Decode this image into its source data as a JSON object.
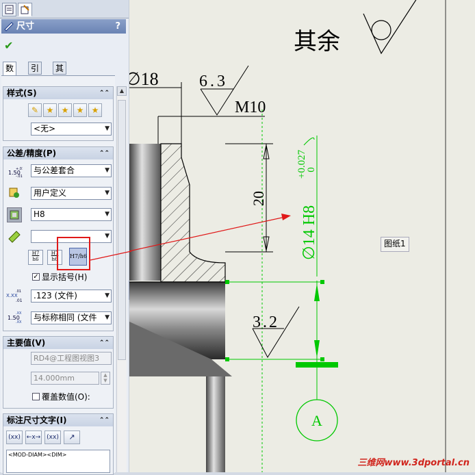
{
  "property_manager": {
    "title": "尺寸",
    "help": "?",
    "tabs": [
      "数值",
      "引线",
      "其它"
    ]
  },
  "style_group": {
    "title": "样式(S)",
    "style_select": "<无>"
  },
  "tolerance_group": {
    "title": "公差/精度(P)",
    "tolerance_type": "与公差套合",
    "classification": "用户定义",
    "hole_fit": "H8",
    "shaft_fit": "",
    "fit_buttons": [
      {
        "top": "H7",
        "bottom": "h6"
      },
      {
        "top": "H7",
        "bottom": "h6"
      },
      {
        "top": "H7",
        "bottom": "h6"
      }
    ],
    "show_parentheses": "显示括号(H)",
    "show_parentheses_checked": true,
    "primary_precision": ".123 (文件)",
    "tolerance_precision": "与标称相同 (文件",
    "icon_label_top": "1.50",
    "icon_label_tol": "+.01\n-.01"
  },
  "primary_value_group": {
    "title": "主要值(V)",
    "reference": "RD4@工程图视图3",
    "value": "14.000mm",
    "override": "覆盖数值(O):"
  },
  "dim_text_group": {
    "title": "标注尺寸文字(I)",
    "text": "<MOD-DIAM><DIM>",
    "buttons": [
      "(xx)",
      "←x→",
      "(xx)",
      "↗"
    ]
  },
  "drawing": {
    "roughness_note": "其余",
    "dim_18": "∅18",
    "roughness_63": "6.3",
    "thread": "M10",
    "dim_20": "20",
    "dim_main": "∅14 H8",
    "tol_upper": "+0.027",
    "tol_lower": "0",
    "roughness_32": "3.2",
    "balloon": "A",
    "sheet_label": "图纸1",
    "watermark": "三维网www.3dportal.cn"
  },
  "colors": {
    "accent_green": "#00c800",
    "annotation_red": "#e01818",
    "pm_header": "#7a91c0"
  }
}
